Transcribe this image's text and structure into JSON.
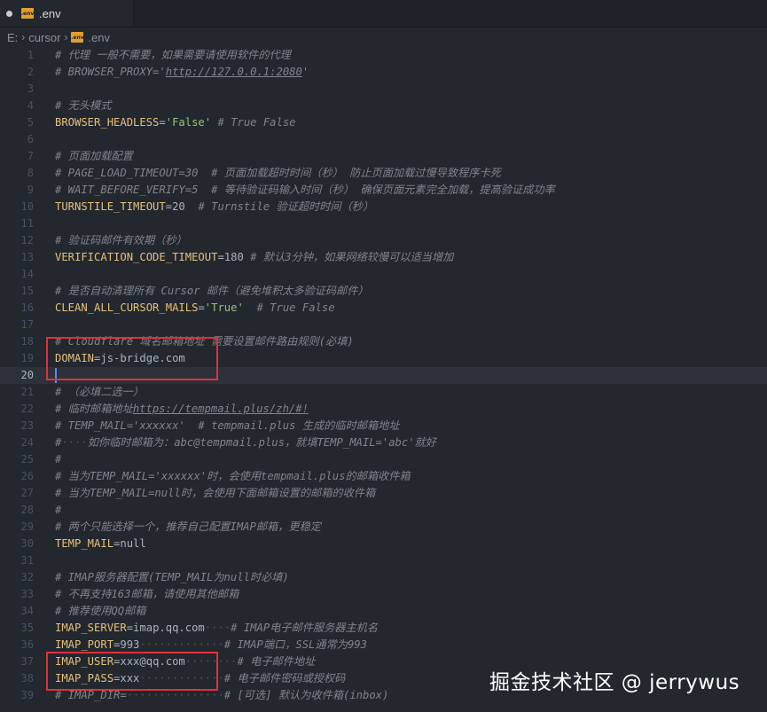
{
  "tab": {
    "label": ".env",
    "icon": "env-file-icon",
    "icon_text": ".env"
  },
  "breadcrumb": {
    "drive": "E:",
    "folder": "cursor",
    "file": ".env"
  },
  "editor": {
    "active_line": 20,
    "lines": [
      {
        "n": "1",
        "seg": [
          {
            "c": "c",
            "t": "# 代理 一般不需要，如果需要请使用软件的代理"
          }
        ]
      },
      {
        "n": "2",
        "seg": [
          {
            "c": "c",
            "t": "# BROWSER_PROXY='"
          },
          {
            "c": "c u",
            "t": "http://127.0.0.1:2080"
          },
          {
            "c": "c",
            "t": "'"
          }
        ]
      },
      {
        "n": "3",
        "seg": []
      },
      {
        "n": "4",
        "seg": [
          {
            "c": "c",
            "t": "# 无头模式"
          }
        ]
      },
      {
        "n": "5",
        "seg": [
          {
            "c": "k",
            "t": "BROWSER_HEADLESS"
          },
          {
            "c": "p",
            "t": "="
          },
          {
            "c": "s",
            "t": "'False'"
          },
          {
            "c": "p",
            "t": " "
          },
          {
            "c": "c",
            "t": "# True False"
          }
        ]
      },
      {
        "n": "6",
        "seg": []
      },
      {
        "n": "7",
        "seg": [
          {
            "c": "c",
            "t": "# 页面加载配置"
          }
        ]
      },
      {
        "n": "8",
        "seg": [
          {
            "c": "c",
            "t": "# PAGE_LOAD_TIMEOUT=30  # 页面加载超时时间（秒） 防止页面加载过慢导致程序卡死"
          }
        ]
      },
      {
        "n": "9",
        "seg": [
          {
            "c": "c",
            "t": "# WAIT_BEFORE_VERIFY=5  # 等待验证码输入时间（秒） 确保页面元素完全加载，提高验证成功率"
          }
        ]
      },
      {
        "n": "10",
        "seg": [
          {
            "c": "k",
            "t": "TURNSTILE_TIMEOUT"
          },
          {
            "c": "p",
            "t": "=20  "
          },
          {
            "c": "c",
            "t": "# Turnstile 验证超时时间（秒）"
          }
        ]
      },
      {
        "n": "11",
        "seg": []
      },
      {
        "n": "12",
        "seg": [
          {
            "c": "c",
            "t": "# 验证码邮件有效期（秒）"
          }
        ]
      },
      {
        "n": "13",
        "seg": [
          {
            "c": "k",
            "t": "VERIFICATION_CODE_TIMEOUT"
          },
          {
            "c": "p",
            "t": "=180 "
          },
          {
            "c": "c",
            "t": "# 默认3分钟，如果网络较慢可以适当增加"
          }
        ]
      },
      {
        "n": "14",
        "seg": []
      },
      {
        "n": "15",
        "seg": [
          {
            "c": "c",
            "t": "# 是否自动清理所有 Cursor 邮件（避免堆积太多验证码邮件）"
          }
        ]
      },
      {
        "n": "16",
        "seg": [
          {
            "c": "k",
            "t": "CLEAN_ALL_CURSOR_MAILS"
          },
          {
            "c": "p",
            "t": "="
          },
          {
            "c": "s",
            "t": "'True'"
          },
          {
            "c": "p",
            "t": "  "
          },
          {
            "c": "c",
            "t": "# True False"
          }
        ]
      },
      {
        "n": "17",
        "seg": []
      },
      {
        "n": "18",
        "seg": [
          {
            "c": "c",
            "t": "# Cloudflare 域名邮箱地址 需要设置邮件路由规则(必填)"
          }
        ]
      },
      {
        "n": "19",
        "seg": [
          {
            "c": "k",
            "t": "DOMAIN"
          },
          {
            "c": "p",
            "t": "=js-bridge.com"
          }
        ]
      },
      {
        "n": "20",
        "seg": []
      },
      {
        "n": "21",
        "seg": [
          {
            "c": "c",
            "t": "# （必填二选一）"
          }
        ]
      },
      {
        "n": "22",
        "seg": [
          {
            "c": "c",
            "t": "# 临时邮箱地址"
          },
          {
            "c": "c u",
            "t": "https://tempmail.plus/zh/#!"
          }
        ]
      },
      {
        "n": "23",
        "seg": [
          {
            "c": "c",
            "t": "# TEMP_MAIL='xxxxxx'  # tempmail.plus 生成的临时邮箱地址"
          }
        ]
      },
      {
        "n": "24",
        "seg": [
          {
            "c": "c",
            "t": "#"
          },
          {
            "c": "w",
            "t": "····"
          },
          {
            "c": "c",
            "t": "如你临时邮箱为：abc@tempmail.plus，就填TEMP_MAIL='abc'就好"
          }
        ]
      },
      {
        "n": "25",
        "seg": [
          {
            "c": "c",
            "t": "#"
          }
        ]
      },
      {
        "n": "26",
        "seg": [
          {
            "c": "c",
            "t": "# 当为TEMP_MAIL='xxxxxx'时，会使用tempmail.plus的邮箱收件箱"
          }
        ]
      },
      {
        "n": "27",
        "seg": [
          {
            "c": "c",
            "t": "# 当为TEMP_MAIL=null时，会使用下面邮箱设置的邮箱的收件箱"
          }
        ]
      },
      {
        "n": "28",
        "seg": [
          {
            "c": "c",
            "t": "#"
          }
        ]
      },
      {
        "n": "29",
        "seg": [
          {
            "c": "c",
            "t": "# 两个只能选择一个，推荐自己配置IMAP邮箱，更稳定"
          }
        ]
      },
      {
        "n": "30",
        "seg": [
          {
            "c": "k",
            "t": "TEMP_MAIL"
          },
          {
            "c": "p",
            "t": "=null"
          }
        ]
      },
      {
        "n": "31",
        "seg": []
      },
      {
        "n": "32",
        "seg": [
          {
            "c": "c",
            "t": "# IMAP服务器配置(TEMP_MAIL为null时必填)"
          }
        ]
      },
      {
        "n": "33",
        "seg": [
          {
            "c": "c",
            "t": "# 不再支持163邮箱，请使用其他邮箱"
          }
        ]
      },
      {
        "n": "34",
        "seg": [
          {
            "c": "c",
            "t": "# 推荐使用QQ邮箱"
          }
        ]
      },
      {
        "n": "35",
        "seg": [
          {
            "c": "k",
            "t": "IMAP_SERVER"
          },
          {
            "c": "p",
            "t": "=imap.qq.com"
          },
          {
            "c": "w",
            "t": "····"
          },
          {
            "c": "c",
            "t": "# IMAP电子邮件服务器主机名"
          }
        ]
      },
      {
        "n": "36",
        "seg": [
          {
            "c": "k",
            "t": "IMAP_PORT"
          },
          {
            "c": "p",
            "t": "=993"
          },
          {
            "c": "w",
            "t": "·············"
          },
          {
            "c": "c",
            "t": "# IMAP端口，SSL通常为993"
          }
        ]
      },
      {
        "n": "37",
        "seg": [
          {
            "c": "k",
            "t": "IMAP_USER"
          },
          {
            "c": "p",
            "t": "=xxx@qq.com"
          },
          {
            "c": "w",
            "t": "········"
          },
          {
            "c": "c",
            "t": "# 电子邮件地址"
          }
        ]
      },
      {
        "n": "38",
        "seg": [
          {
            "c": "k",
            "t": "IMAP_PASS"
          },
          {
            "c": "p",
            "t": "=xxx"
          },
          {
            "c": "w",
            "t": "·············"
          },
          {
            "c": "c",
            "t": "# 电子邮件密码或授权码"
          }
        ]
      },
      {
        "n": "39",
        "seg": [
          {
            "c": "c",
            "t": "# IMAP_DIR="
          },
          {
            "c": "w",
            "t": "···············"
          },
          {
            "c": "c",
            "t": "# [可选] 默认为收件箱(inbox)"
          }
        ]
      }
    ]
  },
  "watermark": "掘金技术社区 @ jerrywus"
}
